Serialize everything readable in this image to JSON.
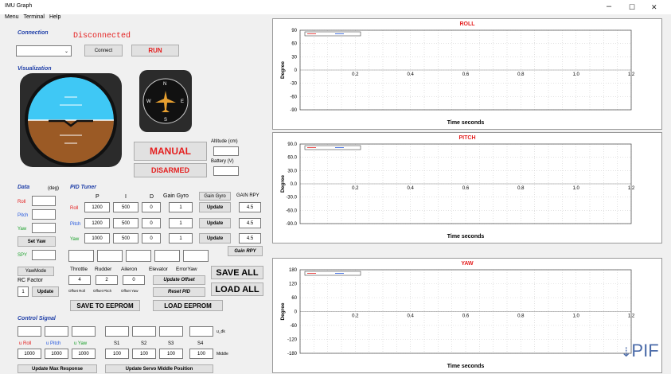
{
  "window": {
    "title": "IMU Graph",
    "min": "–",
    "max": "☐",
    "close": "✕"
  },
  "menu": [
    "Menu",
    "Terminal",
    "Help"
  ],
  "connection": {
    "heading": "Connection",
    "status": "Disconnected",
    "connect": "Connect",
    "run": "RUN"
  },
  "visualization": {
    "heading": "Visualization",
    "mode": "MANUAL",
    "arm": "DISARMED",
    "altitude_label": "Altitude (cm)",
    "battery_label": "Battery (V)",
    "heading_marks": [
      "N",
      "E",
      "S",
      "W"
    ]
  },
  "data": {
    "heading": "Data",
    "unit": "(deg)",
    "roll": "Roll",
    "pitch": "Pitch",
    "yaw": "Yaw",
    "set_yaw": "Set Yaw",
    "spy": "SPY",
    "yaw_mode": "YawMode",
    "rc_factor": "RC Factor",
    "rc_value": "1",
    "update": "Update"
  },
  "pid": {
    "heading": "PID Tuner",
    "cols": [
      "P",
      "I",
      "D",
      "Gain Gyro",
      "Gain Gyro",
      "GAIN RPY"
    ],
    "rows": [
      {
        "name": "Roll",
        "p": "1200",
        "i": "500",
        "d": "0",
        "g": "1",
        "rpy": "4.5"
      },
      {
        "name": "Pitch",
        "p": "1200",
        "i": "500",
        "d": "0",
        "g": "1",
        "rpy": "4.5"
      },
      {
        "name": "Yaw",
        "p": "1000",
        "i": "500",
        "d": "0",
        "g": "1",
        "rpy": "4.5"
      }
    ],
    "update": "Update",
    "gain_rpy": "Gain RPY"
  },
  "offsets": {
    "labels": [
      "Throttle",
      "Rudder",
      "Aileron",
      "Elevator",
      "ErrorYaw"
    ],
    "values": [
      "4",
      "2",
      "0"
    ],
    "sub": [
      "Offset Roll",
      "Offset Pitch",
      "Offset Yaw"
    ],
    "update_offset": "Update Offset",
    "reset_pid": "Reset PID",
    "save_all": "SAVE ALL",
    "load_all": "LOAD ALL",
    "save_eeprom": "SAVE TO EEPROM",
    "load_eeprom": "LOAD EEPROM"
  },
  "control": {
    "heading": "Control Signal",
    "labels": [
      "u Roll",
      "u Pitch",
      "u Yaw",
      "S1",
      "S2",
      "S3",
      "S4"
    ],
    "values": [
      "1000",
      "1000",
      "1000",
      "100",
      "100",
      "100",
      "100"
    ],
    "u_dk": "u_dk",
    "middle": "Middle",
    "max_resp": "Update Max Response",
    "servo_mid": "Update Servo Middle Position"
  },
  "graphs": [
    {
      "title": "ROLL",
      "ylabel": "Degree",
      "xlabel": "Time seconds",
      "yticks": [
        "90",
        "60",
        "30",
        "0",
        "-30",
        "-60",
        "-90"
      ],
      "xticks": [
        "0",
        "0.2",
        "0.4",
        "0.6",
        "0.8",
        "1.0",
        "1.2"
      ]
    },
    {
      "title": "PITCH",
      "ylabel": "Degree",
      "xlabel": "Time seconds",
      "yticks": [
        "90.0",
        "60.0",
        "30.0",
        "0.0",
        "-30.0",
        "-60.0",
        "-90.0"
      ],
      "xticks": [
        "0",
        "0.2",
        "0.4",
        "0.6",
        "0.8",
        "1.0",
        "1.2"
      ]
    },
    {
      "title": "YAW",
      "ylabel": "Degree",
      "xlabel": "Time seconds",
      "yticks": [
        "180",
        "120",
        "60",
        "0",
        "-60",
        "-120",
        "-180"
      ],
      "xticks": [
        "0",
        "0.2",
        "0.4",
        "0.6",
        "0.8",
        "1.0",
        "1.2"
      ]
    }
  ],
  "watermark": "PIF"
}
